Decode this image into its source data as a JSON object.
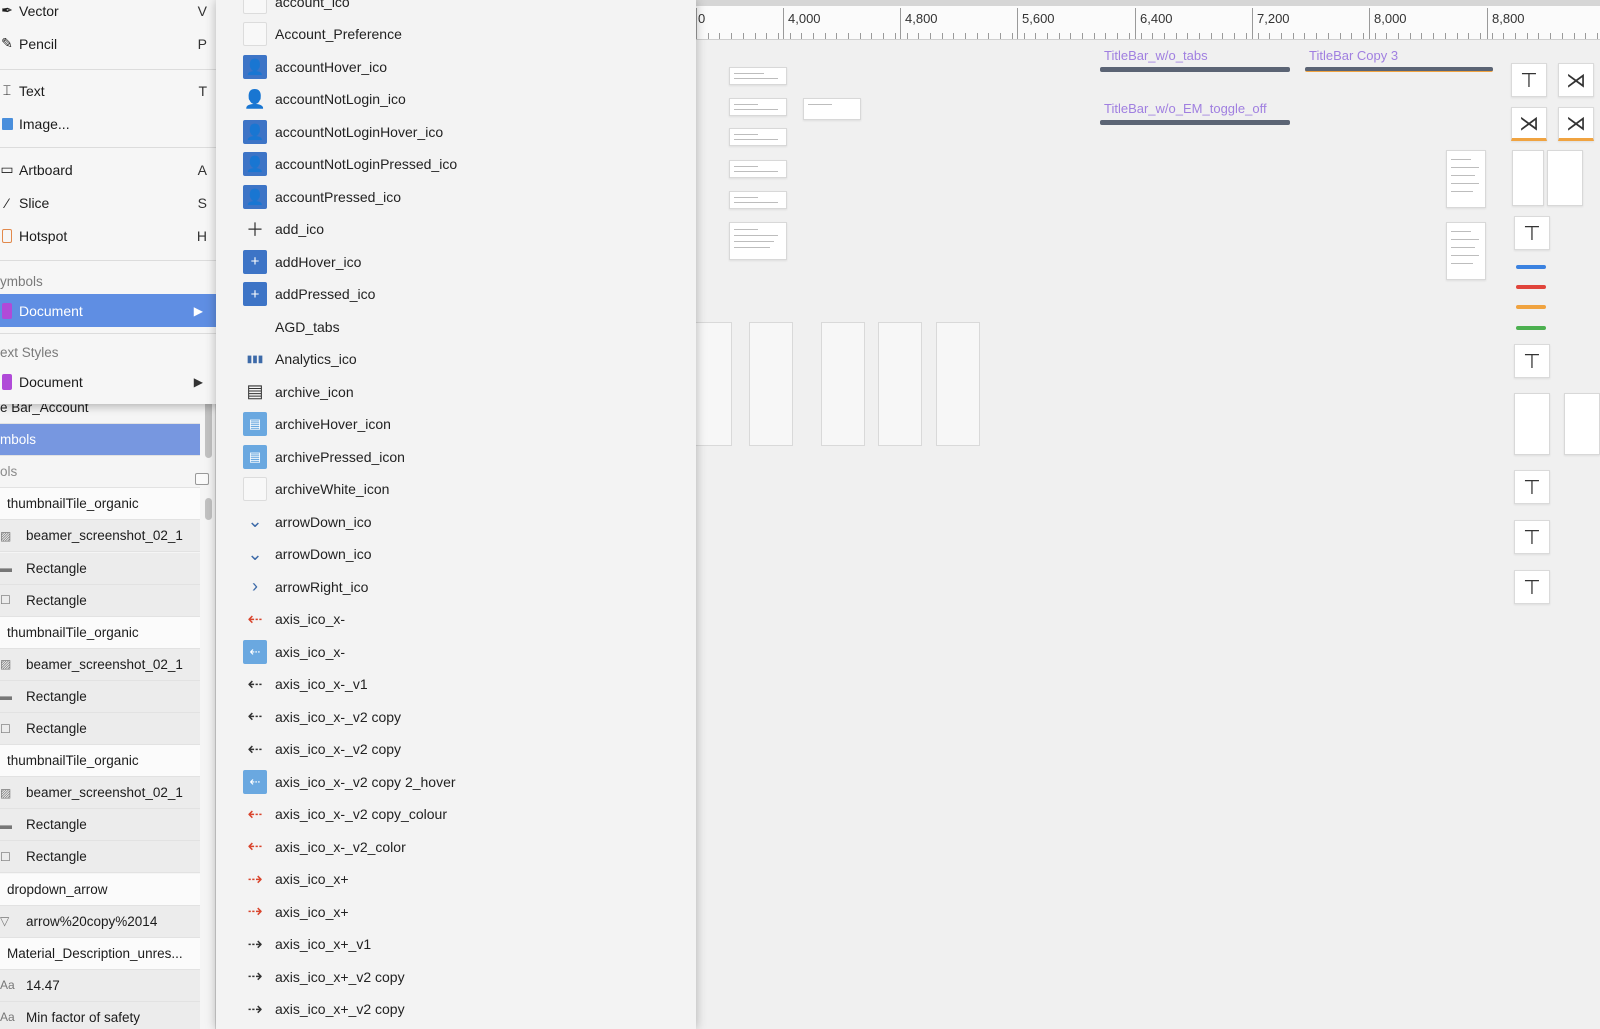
{
  "canvas": {
    "ruler_labels": [
      "0",
      "4,000",
      "4,800",
      "5,600",
      "6,400",
      "7,200",
      "8,000",
      "8,800"
    ],
    "artboards": [
      {
        "label": "TitleBar_w/o_tabs"
      },
      {
        "label": "TitleBar Copy 3"
      },
      {
        "label": "TitleBar_w/o_EM_toggle_off"
      }
    ]
  },
  "insert_menu": {
    "items": [
      {
        "label": "Vector",
        "shortcut": "V",
        "icon": "vector-pen-icon"
      },
      {
        "label": "Pencil",
        "shortcut": "P",
        "icon": "pencil-icon"
      },
      {
        "label": "Text",
        "shortcut": "T",
        "icon": "text-cursor-icon"
      },
      {
        "label": "Image...",
        "shortcut": "",
        "icon": "image-icon"
      },
      {
        "label": "Artboard",
        "shortcut": "A",
        "icon": "artboard-icon"
      },
      {
        "label": "Slice",
        "shortcut": "S",
        "icon": "slice-knife-icon"
      },
      {
        "label": "Hotspot",
        "shortcut": "H",
        "icon": "hotspot-icon"
      }
    ],
    "symbols_header": "ymbols",
    "symbols_document": "Document",
    "text_styles_header": "ext Styles",
    "text_styles_document": "Document"
  },
  "symbols_submenu": {
    "items": [
      "account_ico",
      "Account_Preference",
      "accountHover_ico",
      "accountNotLogin_ico",
      "accountNotLoginHover_ico",
      "accountNotLoginPressed_ico",
      "accountPressed_ico",
      "add_ico",
      "addHover_ico",
      "addPressed_ico",
      "AGD_tabs",
      "Analytics_ico",
      "archive_icon",
      "archiveHover_icon",
      "archivePressed_icon",
      "archiveWhite_icon",
      "arrowDown_ico",
      "arrowDown_ico",
      "arrowRight_ico",
      "axis_ico_x-",
      "axis_ico_x-",
      "axis_ico_x-_v1",
      "axis_ico_x-_v2 copy",
      "axis_ico_x-_v2 copy",
      "axis_ico_x-_v2 copy 2_hover",
      "axis_ico_x-_v2 copy_colour",
      "axis_ico_x-_v2_color",
      "axis_ico_x+",
      "axis_ico_x+",
      "axis_ico_x+_v1",
      "axis_ico_x+_v2 copy",
      "axis_ico_x+_v2 copy"
    ]
  },
  "layers": {
    "rows": [
      {
        "label": "e Bar_Account",
        "kind": "plain"
      },
      {
        "label": "mbols",
        "kind": "selected"
      },
      {
        "label": "ols",
        "kind": "header"
      },
      {
        "label": "thumbnailTile_organic",
        "kind": "group"
      },
      {
        "label": "beamer_screenshot_02_1",
        "kind": "child",
        "icon": "image-layer-icon"
      },
      {
        "label": "Rectangle",
        "kind": "child",
        "icon": "line-layer-icon"
      },
      {
        "label": "Rectangle",
        "kind": "child",
        "icon": "rect-layer-icon"
      },
      {
        "label": "thumbnailTile_organic",
        "kind": "group"
      },
      {
        "label": "beamer_screenshot_02_1",
        "kind": "child",
        "icon": "image-layer-icon"
      },
      {
        "label": "Rectangle",
        "kind": "child",
        "icon": "line-layer-icon"
      },
      {
        "label": "Rectangle",
        "kind": "child",
        "icon": "rect-layer-icon"
      },
      {
        "label": "thumbnailTile_organic",
        "kind": "group"
      },
      {
        "label": "beamer_screenshot_02_1",
        "kind": "child",
        "icon": "image-layer-icon"
      },
      {
        "label": "Rectangle",
        "kind": "child",
        "icon": "line-layer-icon"
      },
      {
        "label": "Rectangle",
        "kind": "child",
        "icon": "rect-layer-icon"
      },
      {
        "label": "dropdown_arrow",
        "kind": "group"
      },
      {
        "label": "arrow%20copy%2014",
        "kind": "child",
        "icon": "triangle-layer-icon"
      },
      {
        "label": "Material_Description_unres...",
        "kind": "group"
      },
      {
        "label": "14.47",
        "kind": "child",
        "icon": "text-layer-icon",
        "icon_text": "Aa"
      },
      {
        "label": "Min factor of safety",
        "kind": "child",
        "icon": "text-layer-icon",
        "icon_text": "Aa"
      }
    ]
  }
}
